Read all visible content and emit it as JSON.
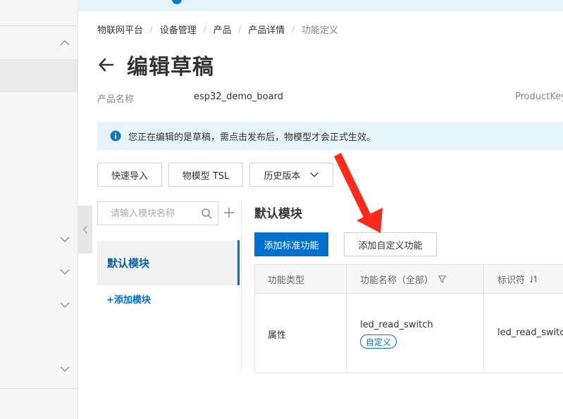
{
  "breadcrumb": [
    "物联网平台",
    "设备管理",
    "产品",
    "产品详情",
    "功能定义"
  ],
  "page": {
    "title": "编辑草稿"
  },
  "product": {
    "name_label": "产品名称",
    "name_value": "esp32_demo_board",
    "productkey_label": "ProductKey"
  },
  "notice": {
    "text": "您正在编辑的是草稿，需点击发布后，物模型才会正式生效。"
  },
  "toolbar": {
    "quick_import": "快速导入",
    "tsl": "物模型 TSL",
    "history": "历史版本"
  },
  "modules": {
    "search_placeholder": "请输入模块名称",
    "items": [
      {
        "label": "默认模块"
      }
    ],
    "add_label": "+添加模块"
  },
  "main": {
    "section_title": "默认模块",
    "add_standard": "添加标准功能",
    "add_custom": "添加自定义功能",
    "table": {
      "headers": [
        "功能类型",
        "功能名称（全部）",
        "标识符"
      ],
      "rows": [
        {
          "type": "属性",
          "name": "led_read_switch",
          "tag": "自定义",
          "identifier": "led_read_switch"
        }
      ]
    }
  },
  "colors": {
    "primary": "#0070cc",
    "annotation_arrow": "#ff2a1a",
    "notice_bg": "#e6f4fb"
  }
}
